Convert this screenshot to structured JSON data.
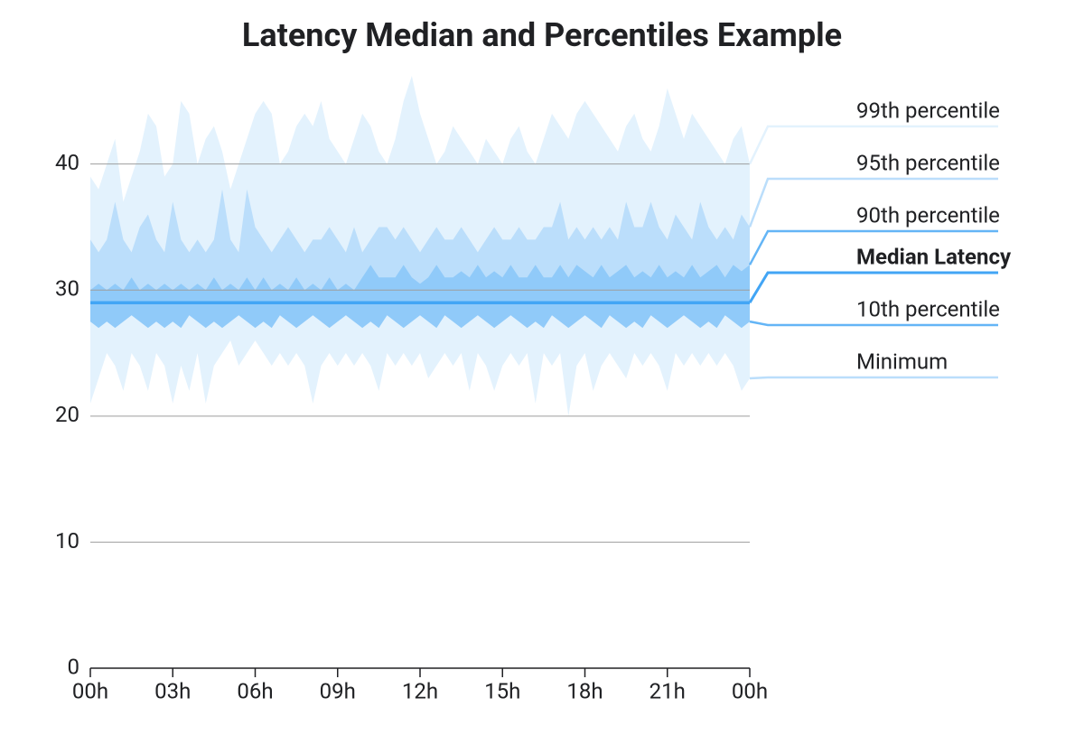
{
  "chart_data": {
    "type": "area",
    "title": "Latency Median and Percentiles Example",
    "xlabel": "",
    "ylabel": "",
    "ylim": [
      0,
      48
    ],
    "xlim": [
      0,
      24
    ],
    "y_ticks": [
      0,
      10,
      20,
      30,
      40
    ],
    "x_ticks": [
      0,
      3,
      6,
      9,
      12,
      15,
      18,
      21,
      24
    ],
    "x_tick_labels": [
      "00h",
      "03h",
      "06h",
      "09h",
      "12h",
      "15h",
      "18h",
      "21h",
      "00h"
    ],
    "colors": {
      "band_outer": "#e3f2fd",
      "band_mid": "#bbdefb",
      "band_inner": "#90caf9",
      "median": "#42a5f5",
      "grid": "#9e9e9e",
      "axis": "#202124",
      "leg_99": "#e3f2fd",
      "leg_95": "#bbdefb",
      "leg_90": "#64b5f6",
      "leg_med": "#42a5f5",
      "leg_10": "#64b5f6",
      "leg_min": "#bbdefb"
    },
    "legend": [
      {
        "key": "p99",
        "label": "99th percentile",
        "bold": false
      },
      {
        "key": "p95",
        "label": "95th percentile",
        "bold": false
      },
      {
        "key": "p90",
        "label": "90th percentile",
        "bold": false
      },
      {
        "key": "median",
        "label": "Median Latency",
        "bold": true
      },
      {
        "key": "p10",
        "label": "10th percentile",
        "bold": false
      },
      {
        "key": "min",
        "label": "Minimum",
        "bold": false
      }
    ],
    "x": [
      0,
      0.3,
      0.6,
      0.9,
      1.2,
      1.5,
      1.8,
      2.1,
      2.4,
      2.7,
      3,
      3.3,
      3.6,
      3.9,
      4.2,
      4.5,
      4.8,
      5.1,
      5.4,
      5.7,
      6,
      6.3,
      6.6,
      6.9,
      7.2,
      7.5,
      7.8,
      8.1,
      8.4,
      8.7,
      9,
      9.3,
      9.6,
      9.9,
      10.2,
      10.5,
      10.8,
      11.1,
      11.4,
      11.7,
      12,
      12.3,
      12.6,
      12.9,
      13.2,
      13.5,
      13.8,
      14.1,
      14.4,
      14.7,
      15,
      15.3,
      15.6,
      15.9,
      16.2,
      16.5,
      16.8,
      17.1,
      17.4,
      17.7,
      18,
      18.3,
      18.6,
      18.9,
      19.2,
      19.5,
      19.8,
      20.1,
      20.4,
      20.7,
      21,
      21.3,
      21.6,
      21.9,
      22.2,
      22.5,
      22.8,
      23.1,
      23.4,
      23.7,
      24
    ],
    "series": {
      "p99": [
        39,
        38,
        40,
        42,
        37,
        39,
        41,
        44,
        43,
        39,
        40,
        45,
        44,
        40,
        42,
        43,
        41,
        38,
        40,
        42,
        44,
        45,
        44,
        40,
        41,
        43,
        44,
        43,
        45,
        42,
        41,
        40,
        42,
        44,
        43,
        41,
        40,
        42,
        45,
        47,
        44,
        42,
        40,
        41,
        43,
        42,
        41,
        40,
        42,
        41,
        40,
        42,
        43,
        41,
        40,
        42,
        44,
        43,
        42,
        44,
        45,
        44,
        43,
        42,
        41,
        43,
        44,
        42,
        41,
        43,
        46,
        44,
        42,
        44,
        43,
        42,
        41,
        40,
        42,
        43,
        40
      ],
      "p95": [
        34,
        33,
        34,
        37,
        34,
        33,
        35,
        36,
        34,
        33,
        37,
        34,
        33,
        34,
        33,
        34,
        38,
        34,
        33,
        38,
        35,
        34,
        33,
        34,
        35,
        34,
        33,
        34,
        34,
        35,
        34,
        33,
        35,
        33,
        34,
        35,
        35,
        34,
        35,
        34,
        33,
        34,
        35,
        34,
        34,
        35,
        34,
        33,
        34,
        35,
        34,
        34,
        35,
        34,
        34,
        35,
        35,
        37,
        34,
        35,
        34,
        35,
        34,
        35,
        34,
        37,
        35,
        35,
        37,
        35,
        34,
        36,
        35,
        34,
        37,
        35,
        34,
        35,
        34,
        36,
        35
      ],
      "p90": [
        30,
        30.5,
        30,
        30.5,
        30,
        31,
        30,
        30.5,
        30,
        30.5,
        30,
        30.5,
        30,
        30.5,
        30,
        31,
        30,
        30.5,
        30,
        31,
        30,
        31,
        30,
        30.5,
        30,
        31,
        30,
        30.5,
        30,
        31,
        30,
        30.5,
        30,
        31,
        32,
        31,
        31,
        31,
        32,
        31,
        30.5,
        31,
        32,
        31,
        31,
        31.5,
        31,
        32,
        31,
        31.5,
        31,
        32,
        31,
        31,
        32,
        31,
        31,
        32,
        31,
        32,
        31.5,
        31,
        32,
        31,
        31.5,
        32,
        31,
        31.5,
        31,
        32,
        31,
        31.5,
        31,
        32,
        31,
        31.5,
        32,
        31,
        32,
        31.5,
        32
      ],
      "median": [
        29,
        29,
        29,
        29,
        29,
        29,
        29,
        29,
        29,
        29,
        29,
        29,
        29,
        29,
        29,
        29,
        29,
        29,
        29,
        29,
        29,
        29,
        29,
        29,
        29,
        29,
        29,
        29,
        29,
        29,
        29,
        29,
        29,
        29,
        29,
        29,
        29,
        29,
        29,
        29,
        29,
        29,
        29,
        29,
        29,
        29,
        29,
        29,
        29,
        29,
        29,
        29,
        29,
        29,
        29,
        29,
        29,
        29,
        29,
        29,
        29,
        29,
        29,
        29,
        29,
        29,
        29,
        29,
        29,
        29,
        29,
        29,
        29,
        29,
        29,
        29,
        29,
        29,
        29,
        29,
        29
      ],
      "p10": [
        27.5,
        27,
        27.5,
        27,
        27.5,
        28,
        27.5,
        27,
        27.5,
        27,
        27.5,
        27,
        28,
        27.5,
        27,
        27.5,
        27,
        27.5,
        28,
        27.5,
        27,
        27.5,
        27,
        28,
        27.5,
        27,
        27.5,
        28,
        27.5,
        27,
        27.5,
        28,
        27.5,
        27,
        27.5,
        27,
        28,
        27.5,
        27,
        27.5,
        28,
        27.5,
        27,
        28,
        27.5,
        27,
        27.5,
        28,
        27.5,
        27,
        27.5,
        28,
        27.5,
        27,
        27.5,
        27,
        28,
        27.5,
        27,
        27.5,
        28,
        27.5,
        27,
        28,
        27.5,
        27,
        27.5,
        27,
        28,
        27.5,
        27,
        27.5,
        28,
        27.5,
        27,
        27.5,
        27,
        28,
        27.5,
        27,
        27.5
      ],
      "min": [
        21,
        23,
        25,
        24,
        22,
        25,
        24,
        22,
        25,
        24,
        21,
        24,
        22,
        25,
        21,
        24,
        25,
        26,
        24,
        25,
        26,
        25,
        24,
        25,
        24,
        25,
        24,
        21,
        24,
        25,
        24,
        25,
        24,
        25,
        24,
        22,
        25,
        24,
        25,
        24,
        25,
        23,
        24,
        25,
        24,
        25,
        22,
        25,
        24,
        22,
        24,
        25,
        24,
        25,
        21,
        25,
        24,
        25,
        20,
        24,
        25,
        22,
        24,
        25,
        24,
        23,
        25,
        24,
        25,
        24,
        22,
        25,
        24,
        25,
        24,
        25,
        24,
        25,
        24,
        22,
        23
      ]
    }
  }
}
